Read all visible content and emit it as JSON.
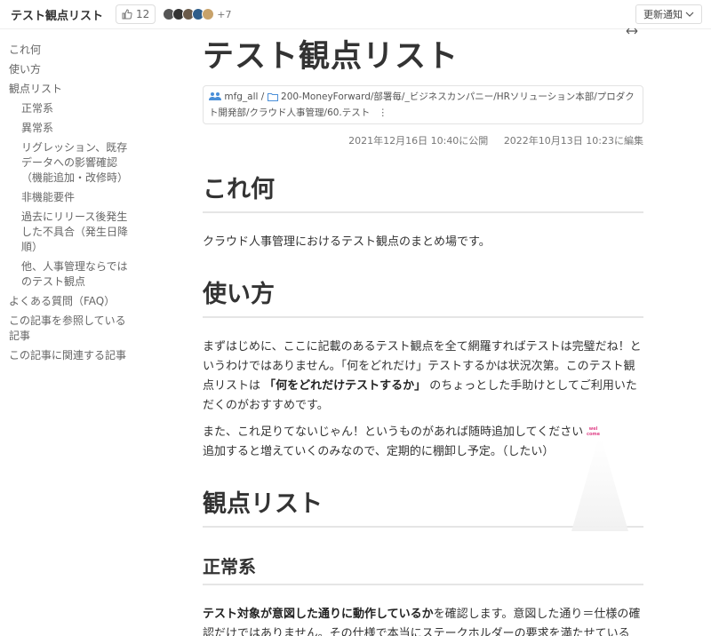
{
  "topbar": {
    "title": "テスト観点リスト",
    "like_count": "12",
    "more_contributors": "+7",
    "update_button": "更新通知",
    "avatar_colors": [
      "#555555",
      "#333333",
      "#6a5a4a",
      "#2f5d8a",
      "#c8a26a"
    ]
  },
  "toc": {
    "items": [
      {
        "label": "これ何",
        "level": 1
      },
      {
        "label": "使い方",
        "level": 1
      },
      {
        "label": "観点リスト",
        "level": 1
      },
      {
        "label": "正常系",
        "level": 2
      },
      {
        "label": "異常系",
        "level": 2
      },
      {
        "label": "リグレッション、既存データへの影響確認（機能追加・改修時）",
        "level": 2
      },
      {
        "label": "非機能要件",
        "level": 2
      },
      {
        "label": "過去にリリース後発生した不具合（発生日降順）",
        "level": 2
      },
      {
        "label": "他、人事管理ならではのテスト観点",
        "level": 2
      },
      {
        "label": "よくある質問（FAQ）",
        "level": 1
      },
      {
        "label": "この記事を参照している記事",
        "level": 1
      },
      {
        "label": "この記事に関連する記事",
        "level": 1
      }
    ]
  },
  "article": {
    "title": "テスト観点リスト",
    "group": "mfg_all",
    "path": "200-MoneyForward/部署毎/_ビジネスカンパニー/HRソリューション本部/プロダクト開発部/クラウド人事管理/60.テスト",
    "path_more": "⋮",
    "published": "2021年12月16日 10:40に公開",
    "edited": "2022年10月13日 10:23に編集",
    "sections": {
      "what": {
        "heading": "これ何",
        "body": "クラウド人事管理におけるテスト観点のまとめ場です。"
      },
      "usage": {
        "heading": "使い方",
        "p1_a": "まずはじめに、ここに記載のあるテスト観点を全て網羅すればテストは完璧だね！というわけではありません。「何をどれだけ」テストするかは状況次第。このテスト観点リストは ",
        "p1_bold": "「何をどれだけテストするか」",
        "p1_b": " のちょっとした手助けとしてご利用いただくのがおすすめです。",
        "p2_a": "また、これ足りてないじゃん！というものがあれば随時追加してください",
        "p2_b": "追加すると増えていくのみなので、定期的に棚卸し予定。（したい）"
      },
      "list": {
        "heading": "観点リスト",
        "normal": {
          "heading": "正常系",
          "bold": "テスト対象が意図した通りに動作しているか",
          "rest": "を確認します。意図した通り＝仕様の確認だけではありません。その仕様で本当にステークホルダーの要求を満たせている"
        }
      }
    }
  }
}
